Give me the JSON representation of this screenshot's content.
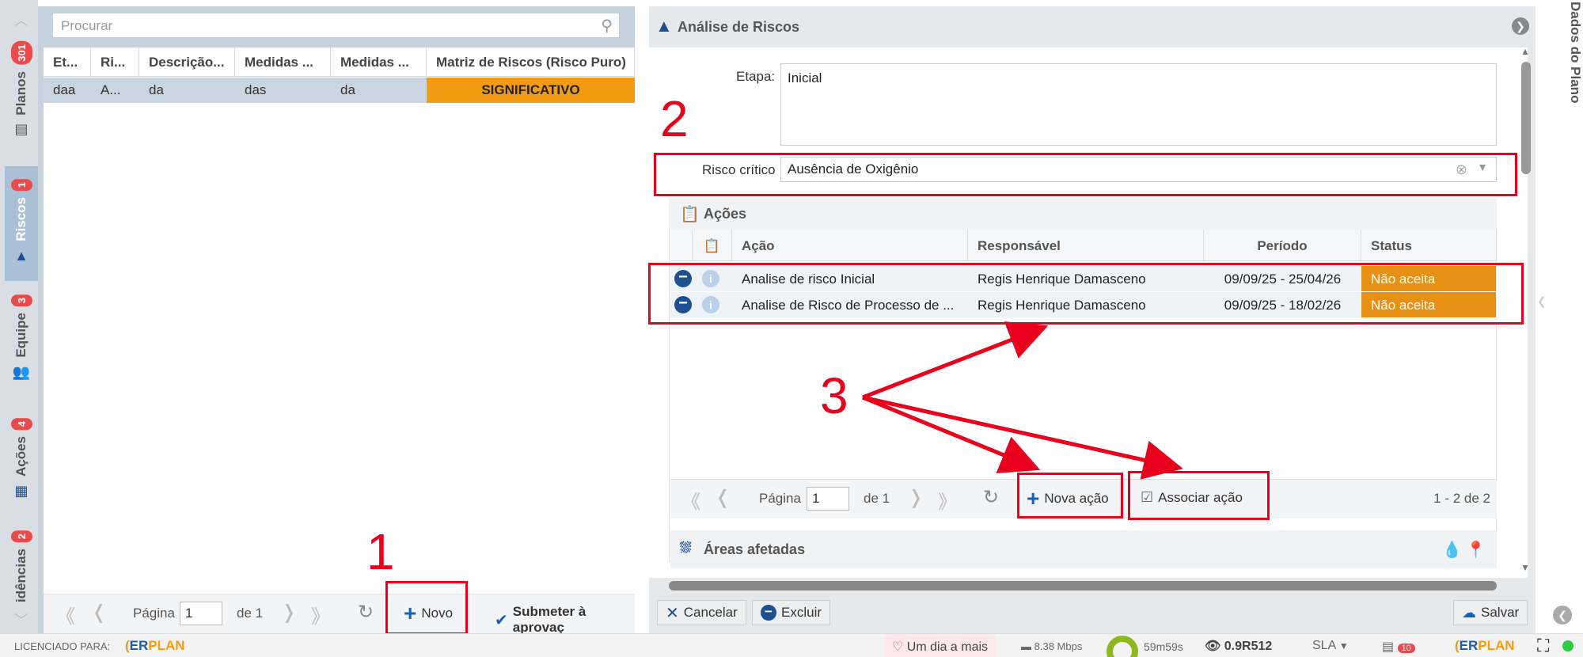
{
  "left_tabs": [
    {
      "label": "Planos",
      "badge": "301"
    },
    {
      "label": "Riscos",
      "badge": "1"
    },
    {
      "label": "Equipe",
      "badge": "3"
    },
    {
      "label": "Ações",
      "badge": "4"
    },
    {
      "label": "idências",
      "badge": "2"
    }
  ],
  "left": {
    "search_placeholder": "Procurar",
    "columns": [
      "Et...",
      "Ri...",
      "Descrição...",
      "Medidas ...",
      "Medidas ...",
      "Matriz de Riscos (Risco Puro)"
    ],
    "row": [
      "daa",
      "A...",
      "da",
      "das",
      "da",
      "SIGNIFICATIVO"
    ],
    "pager": {
      "page_label": "Página",
      "page": "1",
      "of": "de 1"
    },
    "novo": "Novo",
    "submit": "Submeter à aprovaç"
  },
  "right": {
    "title": "Análise de Riscos",
    "etapa_label": "Etapa:",
    "etapa_value": "Inicial",
    "risco_label": "Risco crítico",
    "risco_value": "Ausência de Oxigênio",
    "acoes_title": "Ações",
    "acoes_columns": [
      "Ação",
      "Responsável",
      "Período",
      "Status"
    ],
    "acoes_rows": [
      {
        "acao": "Analise de risco Inicial",
        "resp": "Regis Henrique Damasceno",
        "periodo": "09/09/25 - 25/04/26",
        "status": "Não aceita"
      },
      {
        "acao": "Analise de Risco de Processo de ...",
        "resp": "Regis Henrique Damasceno",
        "periodo": "09/09/25 - 18/02/26",
        "status": "Não aceita"
      }
    ],
    "pager": {
      "page_label": "Página",
      "page": "1",
      "of": "de 1",
      "count": "1 - 2 de 2"
    },
    "nova_acao": "Nova ação",
    "associar_acao": "Associar ação",
    "areas_title": "Áreas afetadas",
    "cancelar": "Cancelar",
    "excluir": "Excluir",
    "salvar": "Salvar",
    "side_tab": "Dados do Plano"
  },
  "annotations": {
    "n1": "1",
    "n2": "2",
    "n3": "3"
  },
  "status": {
    "licenciado": "LICENCIADO PARA:",
    "logo_e": "ER",
    "logo_p": "PLAN",
    "dia": "Um dia a mais",
    "speed": "8.38 Mbps",
    "timer": "59m59s",
    "version": "0.9R512",
    "sla": "SLA",
    "notif": "10"
  },
  "colors": {
    "accent": "#1a5fb4",
    "status_orange": "#e69116",
    "significativo": "#f39c12",
    "annotation_red": "#e8001c"
  }
}
